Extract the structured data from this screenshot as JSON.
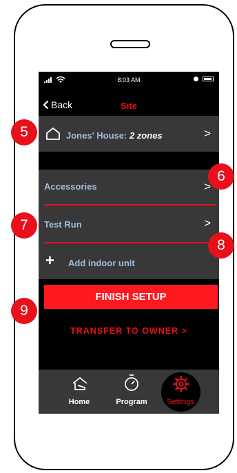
{
  "status": {
    "time": "8:03 AM"
  },
  "nav": {
    "back_label": "Back",
    "title": "Site"
  },
  "site_row": {
    "house_name": "Jones' House:",
    "zones": "2 zones",
    "chevron": ">"
  },
  "list": {
    "accessories": "Accessories",
    "test_run": "Test Run",
    "add_indoor": "Add indoor unit",
    "chevron": ">"
  },
  "finish_button": "FINISH SETUP",
  "transfer_link": "TRANSFER TO OWNER >",
  "tabs": {
    "home": "Home",
    "program": "Program",
    "settings": "Settings"
  },
  "callouts": [
    "5",
    "6",
    "7",
    "8",
    "9"
  ],
  "colors": {
    "accent_red": "#e8101a",
    "panel": "#383838",
    "link_blue": "#9dbddb",
    "button_red": "#ff1a1f"
  },
  "icons": [
    "signal-icon",
    "wifi-icon",
    "battery-icon",
    "back-chevron-icon",
    "house-icon",
    "plus-icon",
    "home-icon",
    "stopwatch-icon",
    "gear-icon"
  ]
}
